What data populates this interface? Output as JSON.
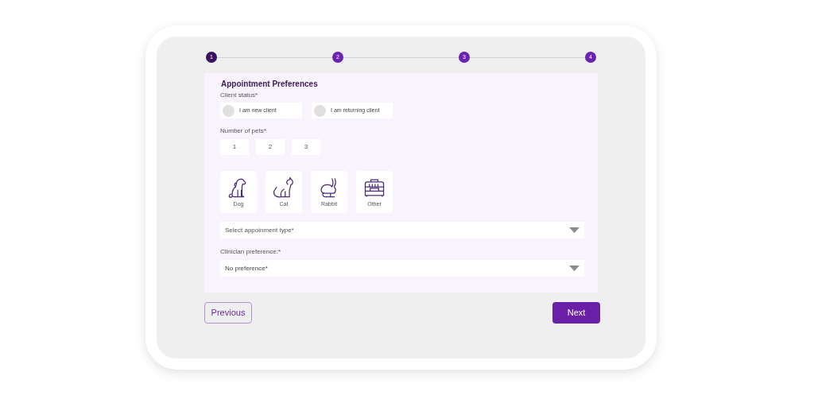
{
  "steps": [
    {
      "label": "1",
      "selected": true
    },
    {
      "label": "2",
      "selected": false
    },
    {
      "label": "3",
      "selected": false
    },
    {
      "label": "4",
      "selected": false
    }
  ],
  "form": {
    "title": "Appointment Preferences",
    "client_status": {
      "label": "Client status*",
      "options": [
        {
          "label": "I am new client",
          "selected": false
        },
        {
          "label": "I am returning client",
          "selected": false
        }
      ]
    },
    "number_of_pets": {
      "label": "Number of pets*",
      "options": [
        {
          "label": "1",
          "selected": false
        },
        {
          "label": "2",
          "selected": false
        },
        {
          "label": "3",
          "selected": false
        }
      ]
    },
    "pets": [
      {
        "kind": "dog",
        "label": "Dog",
        "selected": false
      },
      {
        "kind": "cat",
        "label": "Cat",
        "selected": false
      },
      {
        "kind": "rabbit",
        "label": "Rabbit",
        "selected": false
      },
      {
        "kind": "carrier",
        "label": "Other",
        "selected": false
      }
    ],
    "appointment_type": {
      "placeholder": "Select appoinment type*"
    },
    "clinician": {
      "label": "Clinician preference:*",
      "value": "No preference*"
    }
  },
  "buttons": {
    "previous": "Previous",
    "next": "Next"
  }
}
